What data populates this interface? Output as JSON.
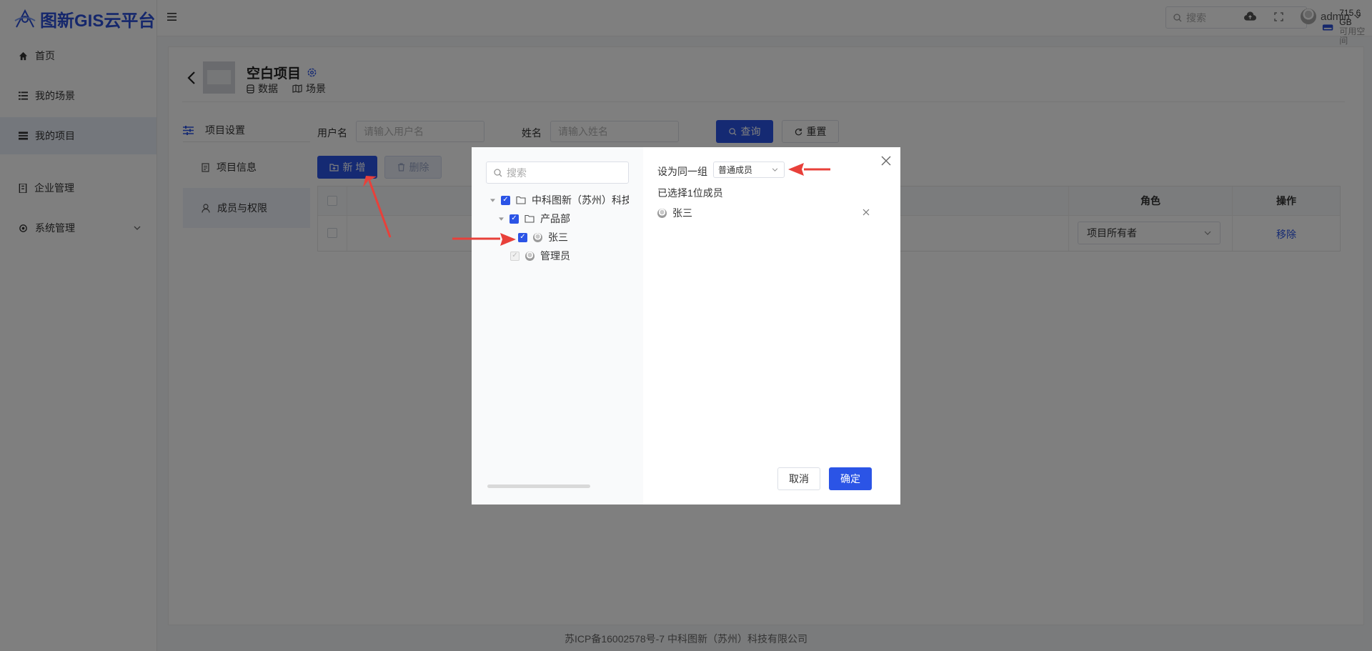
{
  "app": {
    "title": "图新GIS云平台"
  },
  "sidebar": {
    "items": [
      {
        "label": "首页",
        "icon": "home-icon"
      },
      {
        "label": "我的场景",
        "icon": "list-icon"
      },
      {
        "label": "我的项目",
        "icon": "project-icon"
      },
      {
        "label": "企业管理",
        "icon": "building-icon"
      },
      {
        "label": "系统管理",
        "icon": "gear-icon"
      }
    ]
  },
  "topbar": {
    "search_placeholder": "搜索",
    "storage_value": "715.6 GB",
    "storage_label": "可用空间",
    "user": "admin"
  },
  "project": {
    "title": "空白项目",
    "links": [
      "数据",
      "场景"
    ],
    "settings_title": "项目设置",
    "tabs": [
      "项目信息",
      "成员与权限"
    ]
  },
  "filters": {
    "username_label": "用户名",
    "username_placeholder": "请输入用户名",
    "name_label": "姓名",
    "name_placeholder": "请输入姓名",
    "query_button": "查询",
    "reset_button": "重置",
    "add_button": "新 增",
    "delete_button": "删除"
  },
  "table": {
    "headers": {
      "role": "角色",
      "action": "操作"
    },
    "rows": [
      {
        "role": "项目所有者",
        "action": "移除"
      }
    ]
  },
  "footer": {
    "text": "苏ICP备16002578号-7 中科图新（苏州）科技有限公司"
  },
  "modal": {
    "search_placeholder": "搜索",
    "tree": {
      "org": "中科图新（苏州）科技",
      "dept": "产品部",
      "member1": "张三",
      "member2": "管理员"
    },
    "group_label": "设为同一组",
    "group_value": "普通成员",
    "selected_count_text": "已选择1位成员",
    "selected": [
      "张三"
    ],
    "cancel_button": "取消",
    "confirm_button": "确定"
  },
  "colors": {
    "primary": "#2b54e6",
    "brand": "#2b4fd8",
    "arrow": "#e8403a"
  }
}
